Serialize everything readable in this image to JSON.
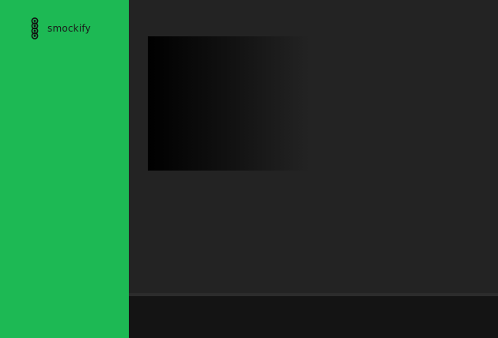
{
  "brand": {
    "name": "smockify",
    "icon": "smockify-logo-icon"
  },
  "colors": {
    "sidebar_bg": "#1db954",
    "main_bg": "#232323",
    "player_bg": "#141414",
    "brand_text": "#1a1a1a"
  }
}
